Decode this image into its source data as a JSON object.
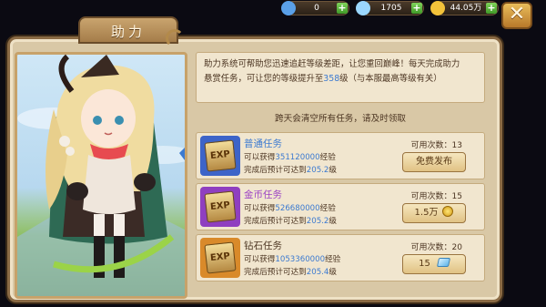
{
  "top_bar": {
    "resources": [
      {
        "icon": "pet-currency-icon",
        "value": "0",
        "color": "#5aa0e8"
      },
      {
        "icon": "diamond-icon",
        "value": "1705",
        "color": "#9ad7ff"
      },
      {
        "icon": "gold-coin-icon",
        "value": "44.05万",
        "color": "#f2c23a"
      }
    ],
    "plus_label": "+",
    "close_label": "✕"
  },
  "panel": {
    "tab_title": "助力",
    "description": {
      "line1": "助力系统可帮助您迅速追赶等级差距，让您重回巅峰！每天完成助力",
      "line2_a": "悬赏任务，可让您的等级提升至",
      "level_cap": "358",
      "line2_b": "级（与本服最高等级有关）"
    },
    "notice": "跨天会清空所有任务，请及时领取",
    "exp_badge": "EXP",
    "tasks": [
      {
        "name": "普通任务",
        "name_color": "#3c7ad0",
        "frame_color": "#3d64c8",
        "gain_prefix": "可以获得",
        "exp_amount": "351120000",
        "gain_suffix": "经验",
        "reach_prefix": "完成后预计可达到",
        "reach_level": "205.2",
        "reach_suffix": "级",
        "uses_label": "可用次数：",
        "uses": "13",
        "button_label": "免费发布",
        "cost_icon": ""
      },
      {
        "name": "金币任务",
        "name_color": "#9a3fc4",
        "frame_color": "#8f3fc0",
        "gain_prefix": "可以获得",
        "exp_amount": "526680000",
        "gain_suffix": "经验",
        "reach_prefix": "完成后预计可达到",
        "reach_level": "205.2",
        "reach_suffix": "级",
        "uses_label": "可用次数：",
        "uses": "15",
        "button_label": "1.5万",
        "cost_icon": "gold-coin-icon"
      },
      {
        "name": "钻石任务",
        "name_color": "#4c3522",
        "frame_color": "#d98a2a",
        "gain_prefix": "可以获得",
        "exp_amount": "1053360000",
        "gain_suffix": "经验",
        "reach_prefix": "完成后预计可达到",
        "reach_level": "205.4",
        "reach_suffix": "级",
        "uses_label": "可用次数：",
        "uses": "20",
        "button_label": "15",
        "cost_icon": "diamond-icon"
      }
    ]
  }
}
